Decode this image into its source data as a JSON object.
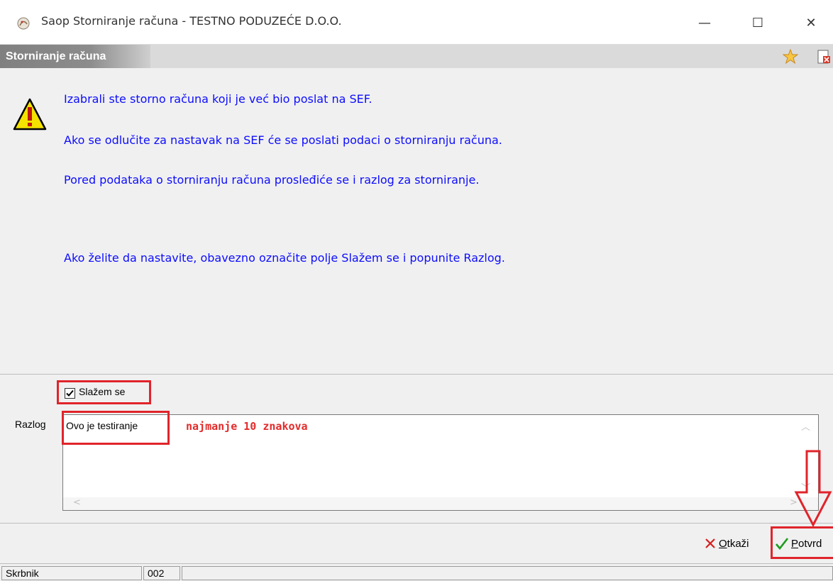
{
  "window": {
    "title": "Saop Storniranje računa - TESTNO PODUZEĆE D.O.O.",
    "minimize_glyph": "—",
    "maximize_glyph": "☐",
    "close_glyph": "✕"
  },
  "header": {
    "title": "Storniranje računa",
    "icons": [
      "favorite-star-icon",
      "document-close-icon"
    ]
  },
  "message": {
    "icon": "warning-icon",
    "lines": [
      "Izabrali ste storno računa koji je već bio poslat na SEF.",
      "Ako se odlučite za nastavak na SEF će se poslati podaci o storniranju računa.",
      "Pored podataka o storniranju računa prosleđiće se i razlog za storniranje.",
      "Ako želite da nastavite, obavezno označite polje Slažem se i popunite Razlog."
    ],
    "text_color": "#0d0dff"
  },
  "agree": {
    "label": "Slažem se",
    "checked": true
  },
  "reason": {
    "label": "Razlog",
    "value": "Ovo je testiranje",
    "hint": "najmanje 10 znakova"
  },
  "buttons": {
    "cancel_prefix": "O",
    "cancel_rest": "tkaži",
    "confirm_prefix": "P",
    "confirm_rest": "otvrd"
  },
  "statusbar": {
    "user": "Skrbnik",
    "code": "002",
    "info": ""
  },
  "colors": {
    "highlight": "#e0242b",
    "hint": "#e32b2b"
  }
}
